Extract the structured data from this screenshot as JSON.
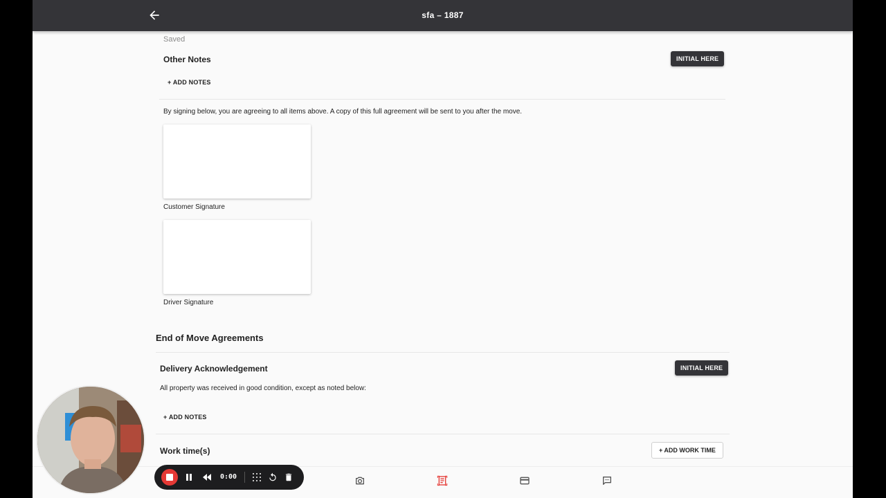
{
  "header": {
    "title": "sfa – 1887"
  },
  "notes_section": {
    "saved_status": "Saved",
    "title": "Other Notes",
    "initial_label": "INITIAL HERE",
    "add_notes_label": "+ ADD NOTES"
  },
  "agreement_text": "By signing below, you are agreeing to all items above. A copy of this full agreement will be sent to you after the move.",
  "signatures": {
    "customer_label": "Customer Signature",
    "driver_label": "Driver Signature"
  },
  "end_of_move": {
    "title": "End of Move Agreements",
    "delivery": {
      "title": "Delivery Acknowledgement",
      "initial_label": "INITIAL HERE",
      "description": "All property was received in good condition, except as noted below:",
      "add_notes_label": "+ ADD NOTES"
    },
    "work_time": {
      "title": "Work time(s)",
      "add_label": "+ ADD WORK TIME"
    }
  },
  "recorder": {
    "time": "0:00"
  },
  "colors": {
    "topbar": "#343438",
    "accent": "#e53935",
    "recorder_bg": "#1d1d1f"
  }
}
